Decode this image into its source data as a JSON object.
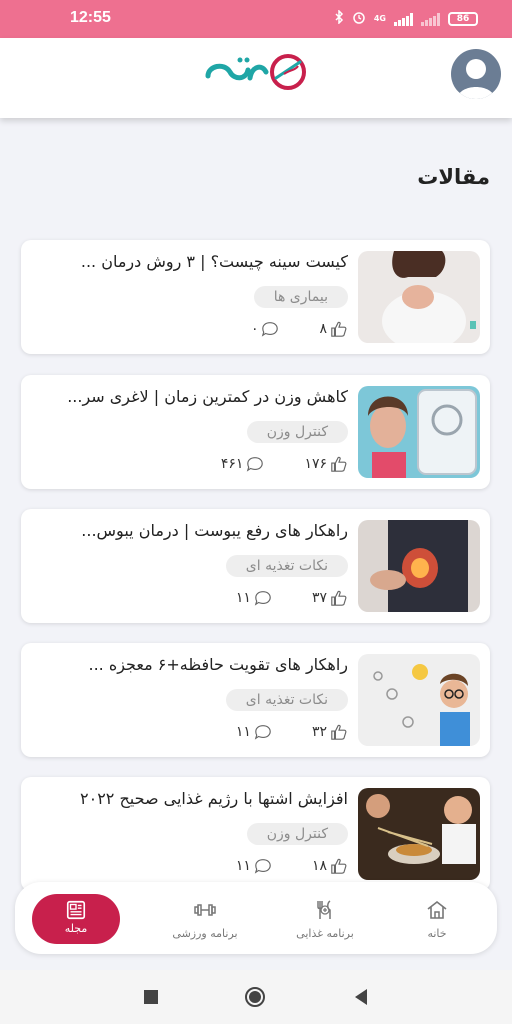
{
  "status_bar": {
    "time": "12:55",
    "battery": "86",
    "network": "4G"
  },
  "header": {
    "logo_text": "زیره",
    "logo_color": "#1fa6a6",
    "logo_accent": "#c8204c"
  },
  "section": {
    "title": "مقالات"
  },
  "articles": [
    {
      "title": "کیست سینه چیست؟ | ۳ روش درمان ...",
      "category": "بیماری ها",
      "likes": "۸",
      "comments": "۰"
    },
    {
      "title": "کاهش وزن در کمترین زمان | لاغری سر...",
      "category": "کنترل وزن",
      "likes": "۱۷۶",
      "comments": "۴۶۱"
    },
    {
      "title": "راهکار های رفع یبوست | درمان یبوس...",
      "category": "نکات تغذیه ای",
      "likes": "۳۷",
      "comments": "۱۱"
    },
    {
      "title": "راهکار های تقویت حافظه+۶ معجزه ...",
      "category": "نکات تغذیه ای",
      "likes": "۳۲",
      "comments": "۱۱"
    },
    {
      "title": "افزایش اشتها با رژیم غذایی صحیح ۲۰۲۲",
      "category": "کنترل وزن",
      "likes": "۱۸",
      "comments": "۱۱"
    }
  ],
  "bottom_nav": {
    "active_color": "#c8204c",
    "items": [
      {
        "label": "مجله",
        "icon": "newspaper-icon"
      },
      {
        "label": "برنامه ورزشی",
        "icon": "dumbbell-icon"
      },
      {
        "label": "برنامه غذایی",
        "icon": "fork-knife-icon"
      },
      {
        "label": "خانه",
        "icon": "home-icon"
      }
    ]
  },
  "colors": {
    "status_bar": "#ee7090",
    "background": "#f2f3f8"
  }
}
